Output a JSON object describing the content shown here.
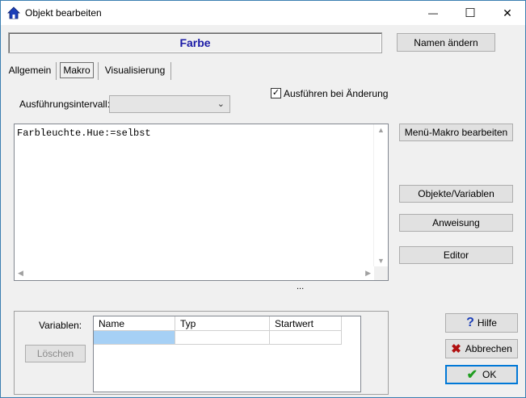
{
  "window": {
    "title": "Objekt bearbeiten",
    "minimize": "—",
    "maximize": "☐",
    "close": "✕"
  },
  "header": {
    "name": "Farbe",
    "rename_button": "Namen ändern"
  },
  "tabs": [
    {
      "label": "Allgemein",
      "active": false
    },
    {
      "label": "Makro",
      "active": true
    },
    {
      "label": "Visualisierung",
      "active": false
    }
  ],
  "macro": {
    "interval_label": "Ausführungsintervall:",
    "interval_value": "",
    "run_on_change_label": "Ausführen bei Änderung",
    "run_on_change_checked": true,
    "code": "Farbleuchte.Hue:=selbst",
    "ellipsis": "..."
  },
  "side_buttons": {
    "menu_macro": "Menü-Makro bearbeiten",
    "objects_vars": "Objekte/Variablen",
    "instruction": "Anweisung",
    "editor": "Editor"
  },
  "variables": {
    "label": "Variablen:",
    "delete_button": "Löschen",
    "columns": [
      "Name",
      "Typ",
      "Startwert"
    ]
  },
  "footer": {
    "help": "Hilfe",
    "cancel": "Abbrechen",
    "ok": "OK"
  },
  "colors": {
    "accent_title": "#1a1aa6",
    "selected_cell": "#a6d0f5",
    "ok_border": "#0078d7"
  }
}
